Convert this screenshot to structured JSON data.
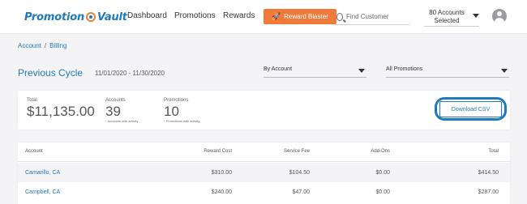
{
  "brand": {
    "logo_left": "Promotion",
    "logo_right": "Vault"
  },
  "nav": {
    "dashboard": "Dashboard",
    "promotions": "Promotions",
    "rewards": "Rewards"
  },
  "reward_blaster": {
    "label": "Reward Blaster",
    "icon": "rocket-icon"
  },
  "search": {
    "placeholder": "Find Customer",
    "value": ""
  },
  "accounts_selector": {
    "line1": "80 Accounts",
    "line2": "Selected"
  },
  "breadcrumb": {
    "account": "Account",
    "separator": "/",
    "billing": "Billing"
  },
  "header": {
    "title": "Previous Cycle",
    "date_range": "11/01/2020 - 11/30/2020"
  },
  "filters": {
    "group_by": "By Account",
    "promotions": "All Promotions"
  },
  "summary": {
    "total": {
      "label": "Total",
      "value": "$11,135.00"
    },
    "accounts": {
      "label": "Accounts",
      "value": "39",
      "note": "* Accounts with activity"
    },
    "promotions": {
      "label": "Promotions",
      "value": "10",
      "note": "* Promotions with activity"
    },
    "download_label": "Download CSV"
  },
  "table": {
    "headers": [
      "Account",
      "Reward Cost",
      "Service Fee",
      "Add-Ons",
      "Total"
    ],
    "rows": [
      [
        "Camarillo, CA",
        "$310.00",
        "$104.50",
        "$0.00",
        "$414.50"
      ],
      [
        "Campbell, CA",
        "$240.00",
        "$47.00",
        "$0.00",
        "$287.00"
      ]
    ]
  },
  "colors": {
    "brand_blue": "#1f7ab9",
    "accent_orange": "#ef7a3b",
    "background": "#f4f4f6"
  }
}
